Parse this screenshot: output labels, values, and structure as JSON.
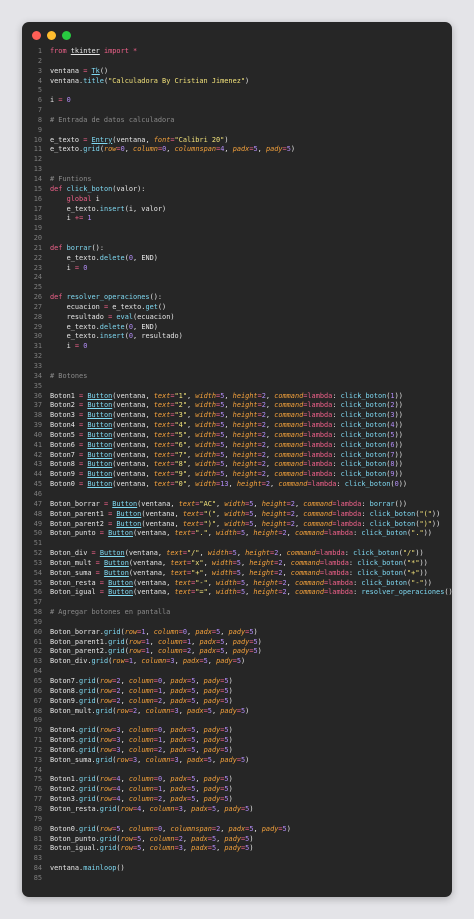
{
  "window": {
    "controls": [
      "close",
      "minimize",
      "zoom"
    ],
    "language": "python"
  },
  "code_lines": [
    "from tkinter import *",
    "",
    "ventana = Tk()",
    "ventana.title(\"Calculadora By Cristian Jimenez\")",
    "",
    "i = 0",
    "",
    "# Entrada de datos calculadora",
    "",
    "e_texto = Entry(ventana, font=\"Calibri 20\")",
    "e_texto.grid(row=0, column=0, columnspan=4, padx=5, pady=5)",
    "",
    "",
    "# Funtions",
    "def click_boton(valor):",
    "    global i",
    "    e_texto.insert(i, valor)",
    "    i += 1",
    "",
    "",
    "def borrar():",
    "    e_texto.delete(0, END)",
    "    i = 0",
    "",
    "",
    "def resolver_operaciones():",
    "    ecuacion = e_texto.get()",
    "    resultado = eval(ecuacion)",
    "    e_texto.delete(0, END)",
    "    e_texto.insert(0, resultado)",
    "    i = 0",
    "",
    "",
    "# Botones",
    "",
    "Boton1 = Button(ventana, text=\"1\", width=5, height=2, command=lambda: click_boton(1))",
    "Boton2 = Button(ventana, text=\"2\", width=5, height=2, command=lambda: click_boton(2))",
    "Boton3 = Button(ventana, text=\"3\", width=5, height=2, command=lambda: click_boton(3))",
    "Boton4 = Button(ventana, text=\"4\", width=5, height=2, command=lambda: click_boton(4))",
    "Boton5 = Button(ventana, text=\"5\", width=5, height=2, command=lambda: click_boton(5))",
    "Boton6 = Button(ventana, text=\"6\", width=5, height=2, command=lambda: click_boton(6))",
    "Boton7 = Button(ventana, text=\"7\", width=5, height=2, command=lambda: click_boton(7))",
    "Boton8 = Button(ventana, text=\"8\", width=5, height=2, command=lambda: click_boton(8))",
    "Boton9 = Button(ventana, text=\"9\", width=5, height=2, command=lambda: click_boton(9))",
    "Boton0 = Button(ventana, text=\"0\", width=13, height=2, command=lambda: click_boton(0))",
    "",
    "Boton_borrar = Button(ventana, text=\"AC\", width=5, height=2, command=lambda: borrar())",
    "Boton_parent1 = Button(ventana, text=\"(\", width=5, height=2, command=lambda: click_boton(\"(\"))",
    "Boton_parent2 = Button(ventana, text=\")\", width=5, height=2, command=lambda: click_boton(\")\"))",
    "Boton_punto = Button(ventana, text=\".\", width=5, height=2, command=lambda: click_boton(\".\"))",
    "",
    "Boton_div = Button(ventana, text=\"/\", width=5, height=2, command=lambda: click_boton(\"/\"))",
    "Boton_mult = Button(ventana, text=\"x\", width=5, height=2, command=lambda: click_boton(\"*\"))",
    "Boton_suma = Button(ventana, text=\"+\", width=5, height=2, command=lambda: click_boton(\"+\"))",
    "Boton_resta = Button(ventana, text=\"-\", width=5, height=2, command=lambda: click_boton(\"-\"))",
    "Boton_igual = Button(ventana, text=\"=\", width=5, height=2, command=lambda: resolver_operaciones())",
    "",
    "# Agregar botones en pantalla",
    "",
    "Boton_borrar.grid(row=1, column=0, padx=5, pady=5)",
    "Boton_parent1.grid(row=1, column=1, padx=5, pady=5)",
    "Boton_parent2.grid(row=1, column=2, padx=5, pady=5)",
    "Boton_div.grid(row=1, column=3, padx=5, pady=5)",
    "",
    "Boton7.grid(row=2, column=0, padx=5, pady=5)",
    "Boton8.grid(row=2, column=1, padx=5, pady=5)",
    "Boton9.grid(row=2, column=2, padx=5, pady=5)",
    "Boton_mult.grid(row=2, column=3, padx=5, pady=5)",
    "",
    "Boton4.grid(row=3, column=0, padx=5, pady=5)",
    "Boton5.grid(row=3, column=1, padx=5, pady=5)",
    "Boton6.grid(row=3, column=2, padx=5, pady=5)",
    "Boton_suma.grid(row=3, column=3, padx=5, pady=5)",
    "",
    "Boton1.grid(row=4, column=0, padx=5, pady=5)",
    "Boton2.grid(row=4, column=1, padx=5, pady=5)",
    "Boton3.grid(row=4, column=2, padx=5, pady=5)",
    "Boton_resta.grid(row=4, column=3, padx=5, pady=5)",
    "",
    "Boton0.grid(row=5, column=0, columnspan=2, padx=5, pady=5)",
    "Boton_punto.grid(row=5, column=2, padx=5, pady=5)",
    "Boton_igual.grid(row=5, column=3, padx=5, pady=5)",
    "",
    "ventana.mainloop()",
    ""
  ],
  "colors": {
    "background": "#262626",
    "keyword": "#f0618a",
    "function": "#7fd9f2",
    "string": "#f2e27a",
    "number": "#b18cf5",
    "argument": "#f5a23c",
    "comment": "#8a8a8a",
    "line_number": "#7d7d7d",
    "text": "#e6e6e6"
  }
}
